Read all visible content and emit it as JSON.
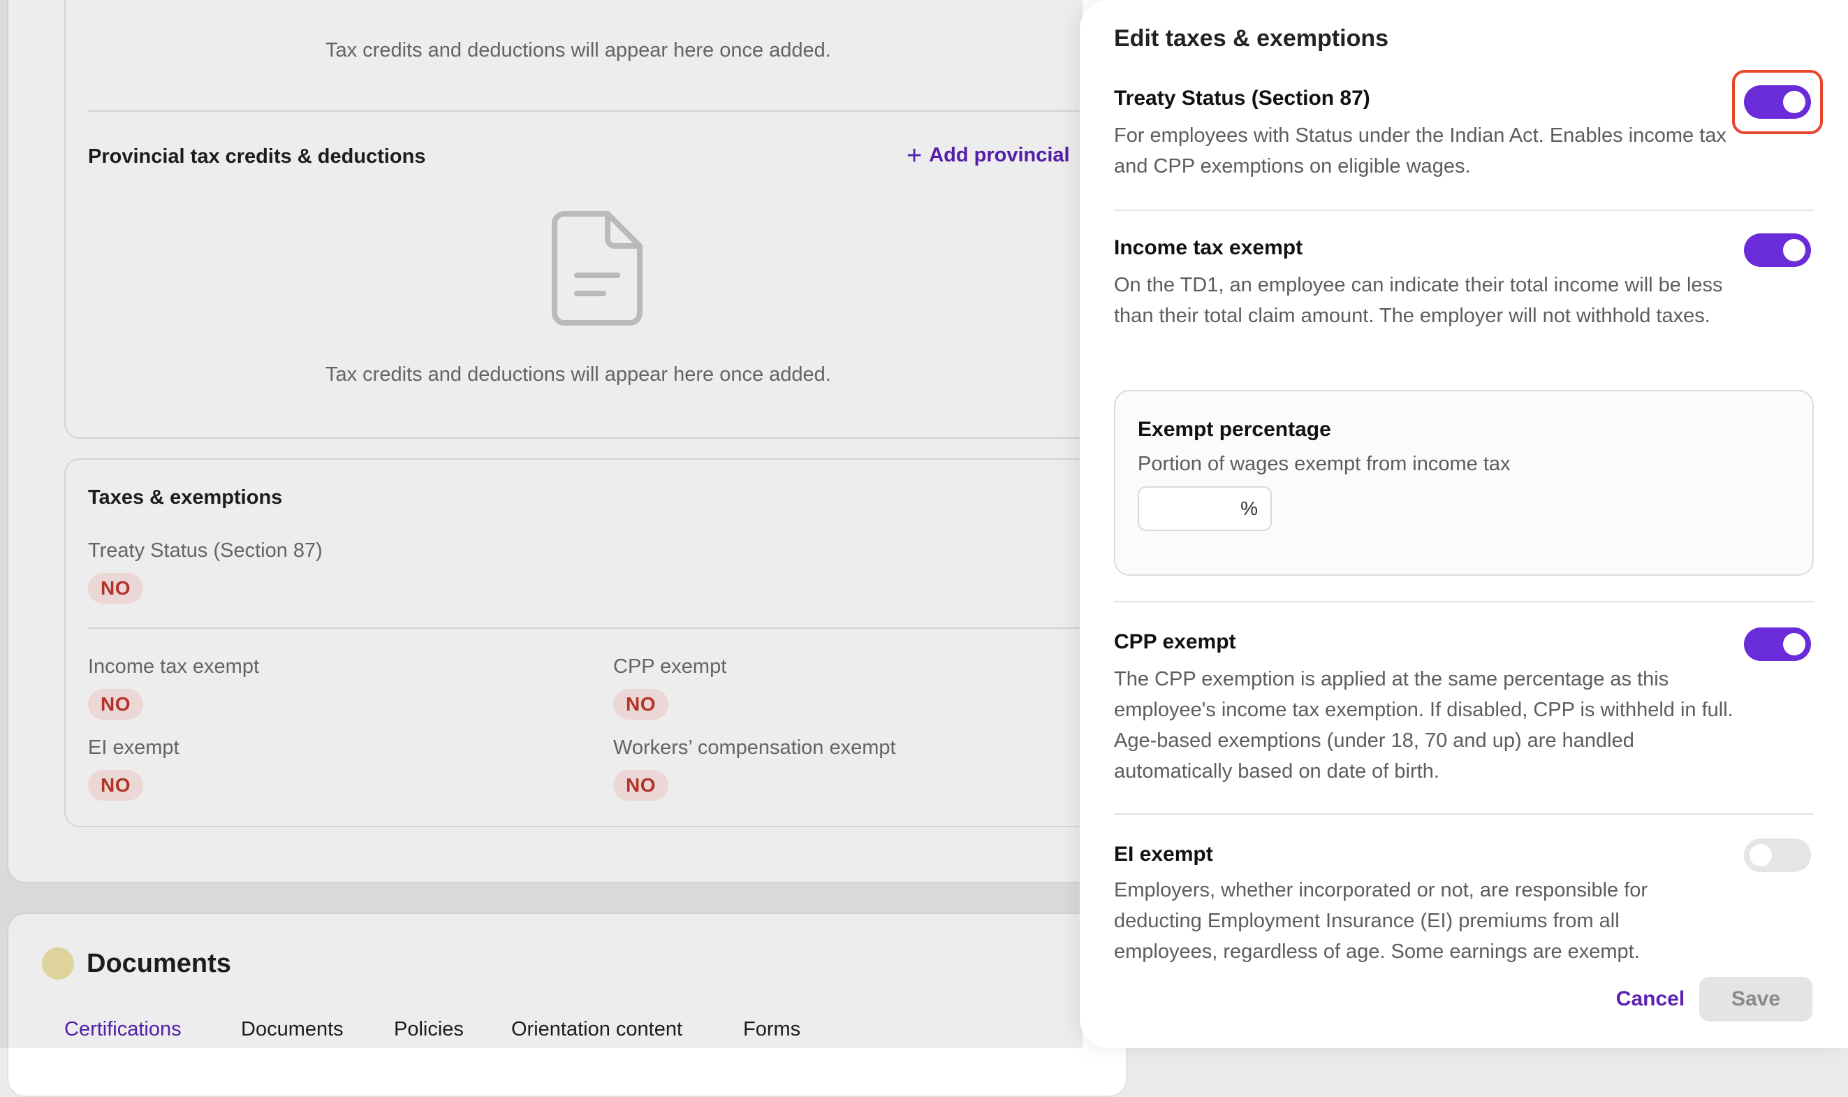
{
  "background": {
    "federal_empty_text": "Tax credits and deductions will appear here once added.",
    "provincial_title": "Provincial tax credits & deductions",
    "add_provincial_label": "Add provincial",
    "provincial_empty_text": "Tax credits and deductions will appear here once added.",
    "taxes_title": "Taxes & exemptions",
    "fields": {
      "treaty_label": "Treaty Status (Section 87)",
      "treaty_value": "NO",
      "income_label": "Income tax exempt",
      "income_value": "NO",
      "cpp_label": "CPP exempt",
      "cpp_value": "NO",
      "ei_label": "EI exempt",
      "ei_value": "NO",
      "workers_label": "Workers’ compensation exempt",
      "workers_value": "NO"
    },
    "documents_title": "Documents",
    "tabs": [
      "Certifications",
      "Documents",
      "Policies",
      "Orientation content",
      "Forms"
    ],
    "active_tab": "Certifications"
  },
  "panel": {
    "title": "Edit taxes & exemptions",
    "treaty": {
      "title": "Treaty Status (Section 87)",
      "desc": "For employees with Status under the Indian Act. Enables income tax and CPP exemptions on eligible wages.",
      "enabled": true
    },
    "income": {
      "title": "Income tax exempt",
      "desc": "On the TD1, an employee can indicate their total income will be less than their total claim amount. The employer will not withhold taxes.",
      "enabled": true
    },
    "exempt_pct": {
      "title": "Exempt percentage",
      "desc": "Portion of wages exempt from income tax",
      "value": "",
      "suffix": "%"
    },
    "cpp": {
      "title": "CPP exempt",
      "desc": "The CPP exemption is applied at the same percentage as this employee's income tax exemption. If disabled, CPP is withheld in full. Age-based exemptions (under 18, 70 and up) are handled automatically based on date of birth.",
      "enabled": true
    },
    "ei": {
      "title": "EI exempt",
      "desc": "Employers, whether incorporated or not, are responsible for deducting Employment Insurance (EI) premiums from all employees, regardless of age. Some earnings are exempt.",
      "enabled": false
    },
    "cancel_label": "Cancel",
    "save_label": "Save"
  },
  "colors": {
    "accent": "#6a2bd8",
    "badge_bg": "#fde9e7",
    "badge_text": "#c0392b",
    "highlight": "#e8452c"
  }
}
